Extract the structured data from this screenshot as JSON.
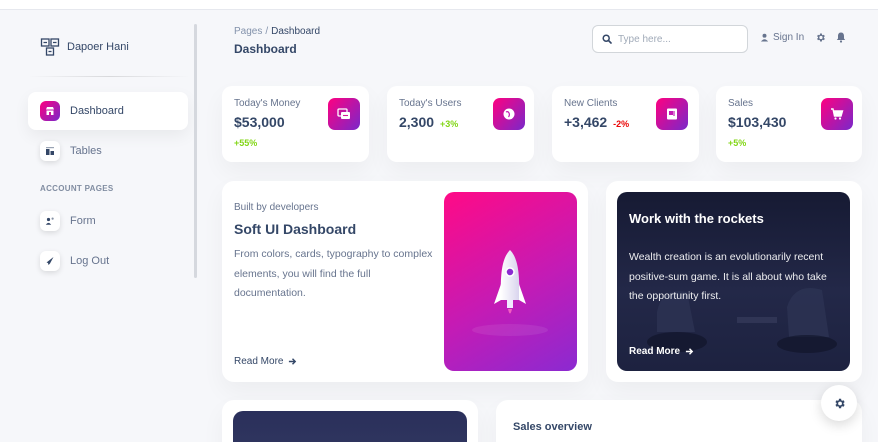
{
  "brand": {
    "name": "Dapoer Hani",
    "icon": "brand-logo-icon"
  },
  "sidebar": {
    "items": [
      {
        "label": "Dashboard",
        "icon": "store-icon",
        "active": true
      },
      {
        "label": "Tables",
        "icon": "table-icon",
        "active": false
      }
    ],
    "section_label": "ACCOUNT PAGES",
    "account_items": [
      {
        "label": "Form",
        "icon": "form-icon"
      },
      {
        "label": "Log Out",
        "icon": "logout-icon"
      }
    ]
  },
  "header": {
    "breadcrumb_root": "Pages",
    "breadcrumb_sep": "/",
    "breadcrumb_current": "Dashboard",
    "title": "Dashboard",
    "search_placeholder": "Type here...",
    "signin_label": "Sign In"
  },
  "stats": [
    {
      "label": "Today's Money",
      "value": "$53,000",
      "change": "",
      "sub": "+55%",
      "icon": "money-icon"
    },
    {
      "label": "Today's Users",
      "value": "2,300",
      "change": "+3%",
      "sub": "",
      "icon": "globe-icon"
    },
    {
      "label": "New Clients",
      "value": "+3,462",
      "change": "-2%",
      "sub": "",
      "icon": "document-icon"
    },
    {
      "label": "Sales",
      "value": "$103,430",
      "change": "",
      "sub": "+5%",
      "icon": "cart-icon"
    }
  ],
  "builder": {
    "small": "Built by developers",
    "title": "Soft UI Dashboard",
    "desc": "From colors, cards, typography to complex elements, you will find the full documentation.",
    "read_more": "Read More"
  },
  "rockets": {
    "title": "Work with the rockets",
    "desc": "Wealth creation is an evolutionarily recent positive-sum game. It is all about who take the opportunity first.",
    "read_more": "Read More"
  },
  "sales": {
    "title": "Sales overview"
  },
  "colors": {
    "accent_start": "#ff0080",
    "accent_end": "#7928ca",
    "positive": "#82d616",
    "negative": "#ea0606",
    "text_dark": "#344767",
    "text_muted": "#67748e"
  }
}
